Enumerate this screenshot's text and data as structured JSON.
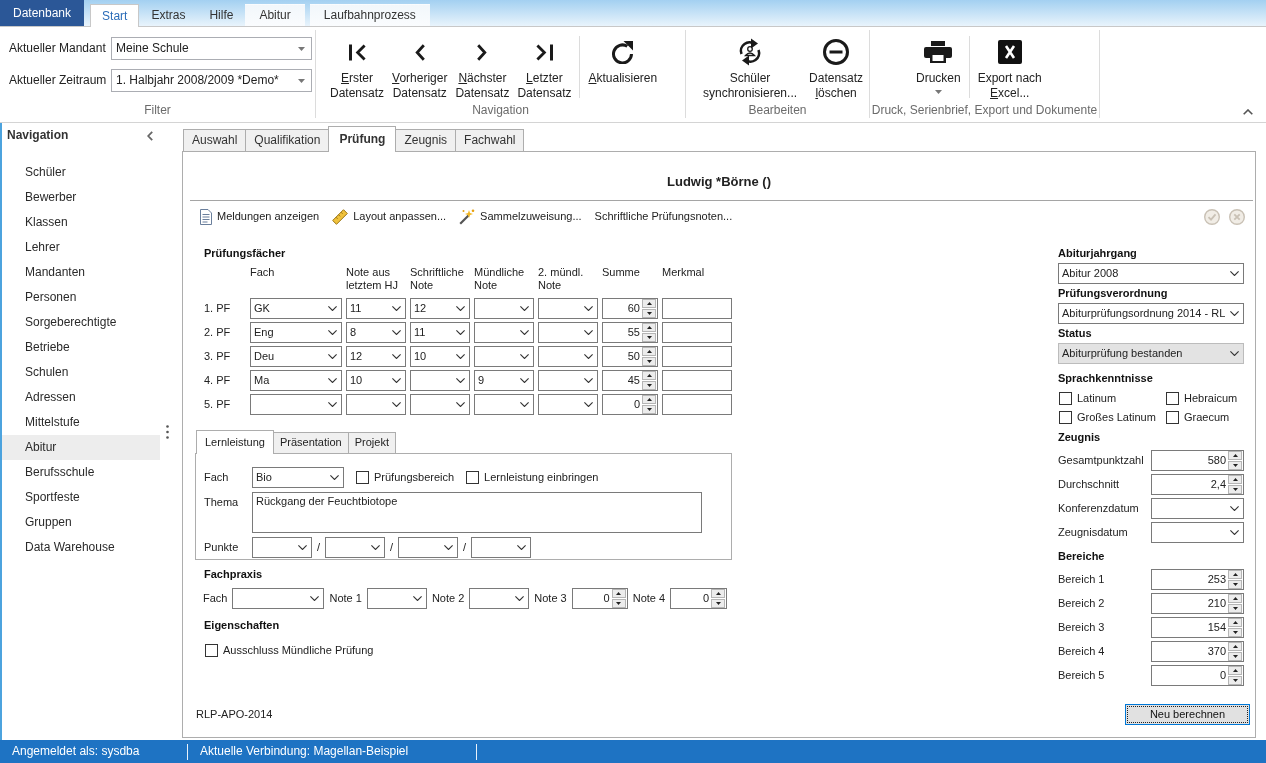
{
  "ribbon": {
    "tabs": [
      {
        "label": "Datenbank",
        "kind": "backstage",
        "selected": false
      },
      {
        "label": "Start",
        "kind": "standard",
        "selected": true
      },
      {
        "label": "Extras",
        "kind": "standard",
        "selected": false
      },
      {
        "label": "Hilfe",
        "kind": "standard",
        "selected": false
      },
      {
        "label": "Abitur",
        "kind": "contextual",
        "selected": false
      },
      {
        "label": "Laufbahnprozess",
        "kind": "contextual",
        "selected": false
      }
    ],
    "filter": {
      "title": "Filter",
      "fields": [
        {
          "label": "Aktueller Mandant",
          "value": "Meine Schule"
        },
        {
          "label": "Aktueller Zeitraum",
          "value": "1. Halbjahr 2008/2009 *Demo*"
        }
      ]
    },
    "groups": [
      {
        "title": "Navigation",
        "buttons": [
          {
            "kind": "first",
            "lines": [
              {
                "text": "Erster",
                "mnemonic": true
              },
              {
                "text": "Datensatz",
                "mnemonic": false
              }
            ],
            "separator_before": false,
            "dropdown": false
          },
          {
            "kind": "previous",
            "lines": [
              {
                "text": "Vorheriger",
                "mnemonic": true
              },
              {
                "text": "Datensatz",
                "mnemonic": false
              }
            ],
            "separator_before": false,
            "dropdown": false
          },
          {
            "kind": "next",
            "lines": [
              {
                "text": "Nächster",
                "mnemonic": true
              },
              {
                "text": "Datensatz",
                "mnemonic": false
              }
            ],
            "separator_before": false,
            "dropdown": false
          },
          {
            "kind": "last",
            "lines": [
              {
                "text": "Letzter",
                "mnemonic": true
              },
              {
                "text": "Datensatz",
                "mnemonic": false
              }
            ],
            "separator_before": false,
            "dropdown": false
          },
          {
            "kind": "refresh",
            "lines": [
              {
                "text": "Aktualisieren",
                "mnemonic": true
              }
            ],
            "separator_before": true,
            "dropdown": false
          }
        ]
      },
      {
        "title": "Bearbeiten",
        "buttons": [
          {
            "kind": "sync",
            "lines": [
              {
                "text": "Schüler",
                "mnemonic": false
              },
              {
                "text": "synchronisieren...",
                "mnemonic": false
              }
            ],
            "separator_before": false,
            "dropdown": false
          },
          {
            "kind": "delete",
            "lines": [
              {
                "text": "Datensatz",
                "mnemonic": false
              },
              {
                "text": "löschen",
                "mnemonic": true
              }
            ],
            "separator_before": false,
            "dropdown": false
          }
        ]
      },
      {
        "title": "Druck, Serienbrief, Export und Dokumente",
        "buttons": [
          {
            "kind": "print",
            "lines": [
              {
                "text": "Drucken",
                "mnemonic": false
              }
            ],
            "separator_before": false,
            "dropdown": true
          },
          {
            "kind": "excel",
            "lines": [
              {
                "text": "Export nach",
                "mnemonic": false
              },
              {
                "text": "Excel...",
                "mnemonic": true
              }
            ],
            "separator_before": true,
            "dropdown": false
          }
        ]
      }
    ]
  },
  "navigation": {
    "title": "Navigation",
    "items": [
      {
        "label": "Schüler",
        "selected": false
      },
      {
        "label": "Bewerber",
        "selected": false
      },
      {
        "label": "Klassen",
        "selected": false
      },
      {
        "label": "Lehrer",
        "selected": false
      },
      {
        "label": "Mandanten",
        "selected": false
      },
      {
        "label": "Personen",
        "selected": false
      },
      {
        "label": "Sorgeberechtigte",
        "selected": false
      },
      {
        "label": "Betriebe",
        "selected": false
      },
      {
        "label": "Schulen",
        "selected": false
      },
      {
        "label": "Adressen",
        "selected": false
      },
      {
        "label": "Mittelstufe",
        "selected": false
      },
      {
        "label": "Abitur",
        "selected": true
      },
      {
        "label": "Berufsschule",
        "selected": false
      },
      {
        "label": "Sportfeste",
        "selected": false
      },
      {
        "label": "Gruppen",
        "selected": false
      },
      {
        "label": "Data Warehouse",
        "selected": false
      }
    ]
  },
  "tabs": [
    {
      "label": "Auswahl",
      "selected": false
    },
    {
      "label": "Qualifikation",
      "selected": false
    },
    {
      "label": "Prüfung",
      "selected": true
    },
    {
      "label": "Zeugnis",
      "selected": false
    },
    {
      "label": "Fachwahl",
      "selected": false
    }
  ],
  "record": {
    "title": "Ludwig *Börne ()",
    "toolbar": [
      {
        "kind": "document",
        "label": "Meldungen anzeigen"
      },
      {
        "kind": "ruler",
        "label": "Layout anpassen..."
      },
      {
        "kind": "wand",
        "label": "Sammelzuweisung..."
      },
      {
        "kind": "plain",
        "label": "Schriftliche Prüfungsnoten..."
      }
    ],
    "actions": [
      {
        "kind": "confirm",
        "disabled": true
      },
      {
        "kind": "cancel",
        "disabled": true
      }
    ]
  },
  "exam_subjects": {
    "title": "Prüfungsfächer",
    "columns": [
      {
        "label": "Fach",
        "kind": "combo"
      },
      {
        "label": "Note aus\nletztem HJ",
        "kind": "combo"
      },
      {
        "label": "Schriftliche\nNote",
        "kind": "combo"
      },
      {
        "label": "Mündliche\nNote",
        "kind": "combo"
      },
      {
        "label": "2. mündl.\nNote",
        "kind": "combo"
      },
      {
        "label": "Summe",
        "kind": "spin"
      },
      {
        "label": "Merkmal",
        "kind": "text"
      }
    ],
    "rows": [
      {
        "label": "1. PF",
        "fach": "GK",
        "note_hj": "11",
        "schriftlich": "12",
        "summe": "60"
      },
      {
        "label": "2. PF",
        "fach": "Eng",
        "note_hj": "8",
        "schriftlich": "11",
        "summe": "55"
      },
      {
        "label": "3. PF",
        "fach": "Deu",
        "note_hj": "12",
        "schriftlich": "10",
        "summe": "50"
      },
      {
        "label": "4. PF",
        "fach": "Ma",
        "note_hj": "10",
        "muendlich": "9",
        "summe": "45"
      },
      {
        "label": "5. PF",
        "summe": "0"
      }
    ]
  },
  "sub_tabs": [
    {
      "label": "Lernleistung",
      "selected": true
    },
    {
      "label": "Präsentation",
      "selected": false
    },
    {
      "label": "Projekt",
      "selected": false
    }
  ],
  "lernleistung": {
    "fach_label": "Fach",
    "fach": "Bio",
    "options": [
      {
        "label": "Prüfungsbereich",
        "checked": false
      },
      {
        "label": "Lernleistung einbringen",
        "checked": false
      }
    ],
    "thema_label": "Thema",
    "thema": "Rückgang der Feuchtbiotope",
    "punkte_label": "Punkte",
    "punkte_separators": [
      "/",
      "/",
      "/"
    ]
  },
  "fachpraxis": {
    "title": "Fachpraxis",
    "fields": [
      {
        "label": "Fach",
        "kind": "combo"
      },
      {
        "label": "Note 1",
        "kind": "combo"
      },
      {
        "label": "Note 2",
        "kind": "combo"
      },
      {
        "label": "Note 3",
        "kind": "spin",
        "value": "0"
      },
      {
        "label": "Note 4",
        "kind": "spin",
        "value": "0"
      }
    ]
  },
  "eigenschaften": {
    "title": "Eigenschaften",
    "options": [
      {
        "label": "Ausschluss Mündliche Prüfung",
        "checked": false
      }
    ]
  },
  "regulation_code": "RLP-APO-2014",
  "side_panel": {
    "selects": [
      {
        "title": "Abiturjahrgang",
        "value": "Abitur 2008",
        "disabled": false
      },
      {
        "title": "Prüfungsverordnung",
        "value": "Abiturprüfungsordnung 2014 - RL",
        "disabled": false
      },
      {
        "title": "Status",
        "value": "Abiturprüfung bestanden",
        "disabled": true
      }
    ],
    "languages": {
      "title": "Sprachkenntnisse",
      "options": [
        {
          "label": "Latinum",
          "checked": false
        },
        {
          "label": "Hebraicum",
          "checked": false
        },
        {
          "label": "Großes Latinum",
          "checked": false
        },
        {
          "label": "Graecum",
          "checked": false
        }
      ]
    },
    "zeugnis": {
      "title": "Zeugnis",
      "fields": [
        {
          "label": "Gesamtpunktzahl",
          "kind": "spin",
          "value": "580"
        },
        {
          "label": "Durchschnitt",
          "kind": "spin",
          "value": "2,4"
        },
        {
          "label": "Konferenzdatum",
          "kind": "combo"
        },
        {
          "label": "Zeugnisdatum",
          "kind": "combo"
        }
      ]
    },
    "bereiche": {
      "title": "Bereiche",
      "fields": [
        {
          "label": "Bereich 1",
          "kind": "spin",
          "value": "253"
        },
        {
          "label": "Bereich 2",
          "kind": "spin",
          "value": "210"
        },
        {
          "label": "Bereich 3",
          "kind": "spin",
          "value": "154"
        },
        {
          "label": "Bereich 4",
          "kind": "spin",
          "value": "370"
        },
        {
          "label": "Bereich 5",
          "kind": "spin",
          "value": "0"
        }
      ]
    }
  },
  "recalc_button": {
    "label": "Neu berechnen",
    "focused": true
  },
  "status_bar": [
    "Angemeldet als: sysdba",
    "Aktuelle Verbindung: Magellan-Beispiel"
  ]
}
